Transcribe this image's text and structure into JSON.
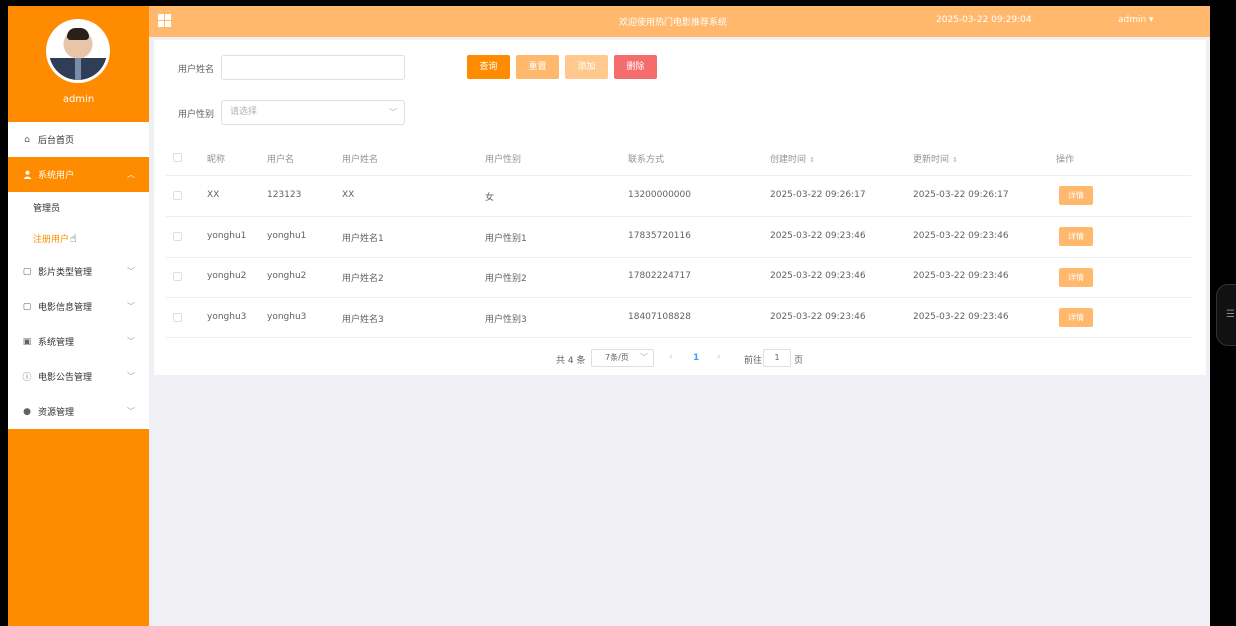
{
  "header": {
    "title": "欢迎使用热门电影推荐系统",
    "datetime": "2025-03-22 09:29:04",
    "user": "admin ▾"
  },
  "sidebar": {
    "username": "admin",
    "items": [
      {
        "label": "后台首页",
        "icon": "home-icon"
      },
      {
        "label": "系统用户",
        "icon": "user-icon"
      },
      {
        "label": "管理员"
      },
      {
        "label": "注册用户"
      },
      {
        "label": "影片类型管理",
        "icon": "document-icon"
      },
      {
        "label": "电影信息管理",
        "icon": "document-icon"
      },
      {
        "label": "系统管理",
        "icon": "image-icon"
      },
      {
        "label": "电影公告管理",
        "icon": "info-icon"
      },
      {
        "label": "资源管理",
        "icon": "location-icon"
      }
    ]
  },
  "search": {
    "name_label": "用户姓名",
    "name_value": "",
    "gender_label": "用户性别",
    "gender_placeholder": "请选择"
  },
  "toolbar": {
    "query": "查询",
    "reset": "重置",
    "add": "添加",
    "delete": "删除"
  },
  "table": {
    "columns": [
      "昵称",
      "用户名",
      "用户姓名",
      "用户性别",
      "联系方式",
      "创建时间",
      "更新时间",
      "操作"
    ],
    "rows": [
      [
        "XX",
        "123123",
        "XX",
        "女",
        "13200000000",
        "2025-03-22 09:26:17",
        "2025-03-22 09:26:17"
      ],
      [
        "yonghu1",
        "yonghu1",
        "用户姓名1",
        "用户性别1",
        "17835720116",
        "2025-03-22 09:23:46",
        "2025-03-22 09:23:46"
      ],
      [
        "yonghu2",
        "yonghu2",
        "用户姓名2",
        "用户性别2",
        "17802224717",
        "2025-03-22 09:23:46",
        "2025-03-22 09:23:46"
      ],
      [
        "yonghu3",
        "yonghu3",
        "用户姓名3",
        "用户性别3",
        "18407108828",
        "2025-03-22 09:23:46",
        "2025-03-22 09:23:46"
      ]
    ],
    "detail_label": "详情"
  },
  "pagination": {
    "total": "共 4 条",
    "page_size": "7条/页",
    "current_page": "1",
    "goto_label": "前往",
    "goto_value": "1",
    "page_suffix": "页"
  },
  "colors": {
    "accent": "#ff8c00",
    "header": "#ffb86c",
    "delete": "#f56c6c"
  }
}
